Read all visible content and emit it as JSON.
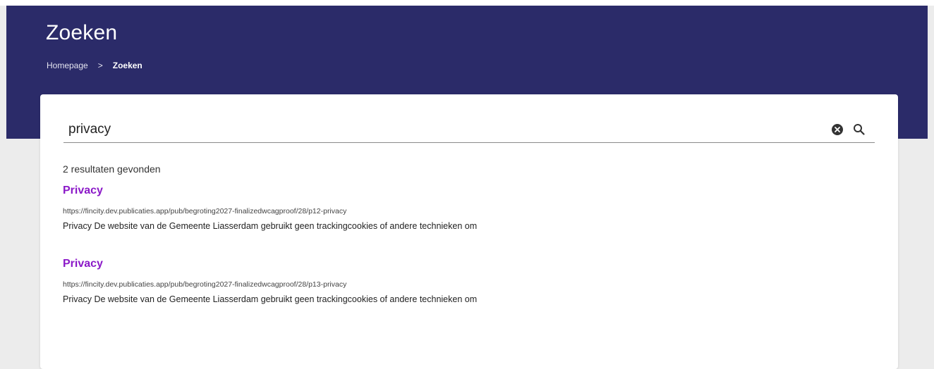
{
  "header": {
    "title": "Zoeken",
    "background_color": "#2b2b69",
    "breadcrumb": {
      "home": "Homepage",
      "separator": ">",
      "current": "Zoeken"
    }
  },
  "search": {
    "value": "privacy",
    "clear_icon": "clear-circle-icon",
    "search_icon": "search-icon"
  },
  "results": {
    "count_text": "2 resultaten gevonden",
    "link_color": "#8b19c8",
    "items": [
      {
        "title": "Privacy",
        "url": "https://fincity.dev.publicaties.app/pub/begroting2027-finalizedwcagproof/28/p12-privacy",
        "snippet": "Privacy De website van de Gemeente Liasserdam gebruikt geen trackingcookies of andere technieken om"
      },
      {
        "title": "Privacy",
        "url": "https://fincity.dev.publicaties.app/pub/begroting2027-finalizedwcagproof/28/p13-privacy",
        "snippet": "Privacy De website van de Gemeente Liasserdam gebruikt geen trackingcookies of andere technieken om"
      }
    ]
  }
}
